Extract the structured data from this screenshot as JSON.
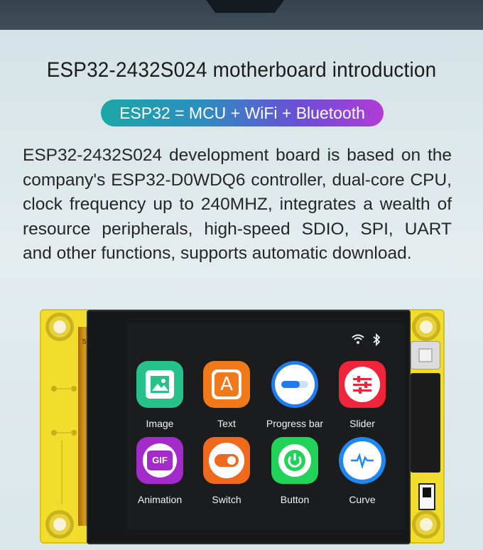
{
  "header": {
    "title": "ESP32-2432S024 motherboard introduction",
    "pill": "ESP32 = MCU + WiFi + Bluetooth"
  },
  "description": "ESP32-2432S024 development board is based on the company's ESP32-D0WDQ6 controller, dual-core CPU, clock frequency up to 240MHZ, integrates a wealth of resource peripherals, high-speed SDIO, SPI, UART and other functions, supports automatic download.",
  "screen": {
    "status_icons": [
      "wifi-icon",
      "bluetooth-icon"
    ],
    "apps": [
      {
        "label": "Image",
        "icon": "image-icon",
        "color": "#27c28a"
      },
      {
        "label": "Text",
        "icon": "text-icon",
        "color": "#f07a1a"
      },
      {
        "label": "Progress bar",
        "icon": "progress-bar-icon",
        "color": "#1e7bf0"
      },
      {
        "label": "Slider",
        "icon": "slider-icon",
        "color": "#f0243a"
      },
      {
        "label": "Animation",
        "icon": "gif-icon",
        "color": "#a22bc9"
      },
      {
        "label": "Switch",
        "icon": "switch-icon",
        "color": "#f06a1e"
      },
      {
        "label": "Button",
        "icon": "power-button-icon",
        "color": "#22d35a"
      },
      {
        "label": "Curve",
        "icon": "curve-icon",
        "color": "#1e88f0"
      }
    ]
  },
  "board": {
    "pcb_marking": "5"
  }
}
